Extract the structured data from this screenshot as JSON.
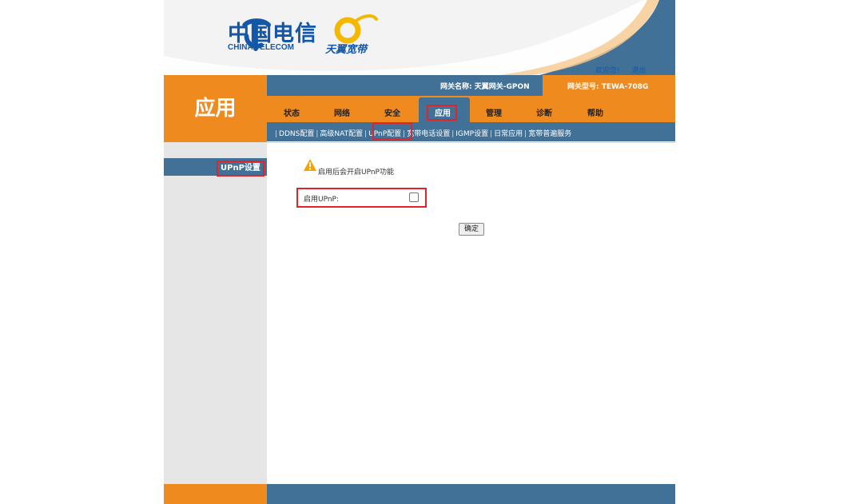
{
  "header": {
    "logo_cn": "中国电信",
    "logo_en": "CHINA TELECOM",
    "brand": "天翼宽带",
    "links": [
      "欢迎您!",
      "退出"
    ]
  },
  "section_title": "应用",
  "gateway": {
    "name_label": "网关名称: 天翼网关-GPON",
    "model_label": "网关型号: TEWA-708G"
  },
  "tabs": [
    "状态",
    "网络",
    "安全",
    "应用",
    "管理",
    "诊断",
    "帮助"
  ],
  "active_tab": "应用",
  "subnav": [
    "DDNS配置",
    "高级NAT配置",
    "UPnP配置",
    "宽带电话设置",
    "IGMP设置",
    "日常应用",
    "宽带普遍服务"
  ],
  "active_subnav": "UPnP配置",
  "sidebar": {
    "item": "UPnP设置"
  },
  "content": {
    "warning": "启用后会开启UPnP功能",
    "enable_label": "启用UPnP:",
    "enable_checked": false,
    "ok_button": "确定"
  },
  "colors": {
    "blue": "#417196",
    "orange": "#ef8a1f",
    "highlight": "#e1242a"
  }
}
